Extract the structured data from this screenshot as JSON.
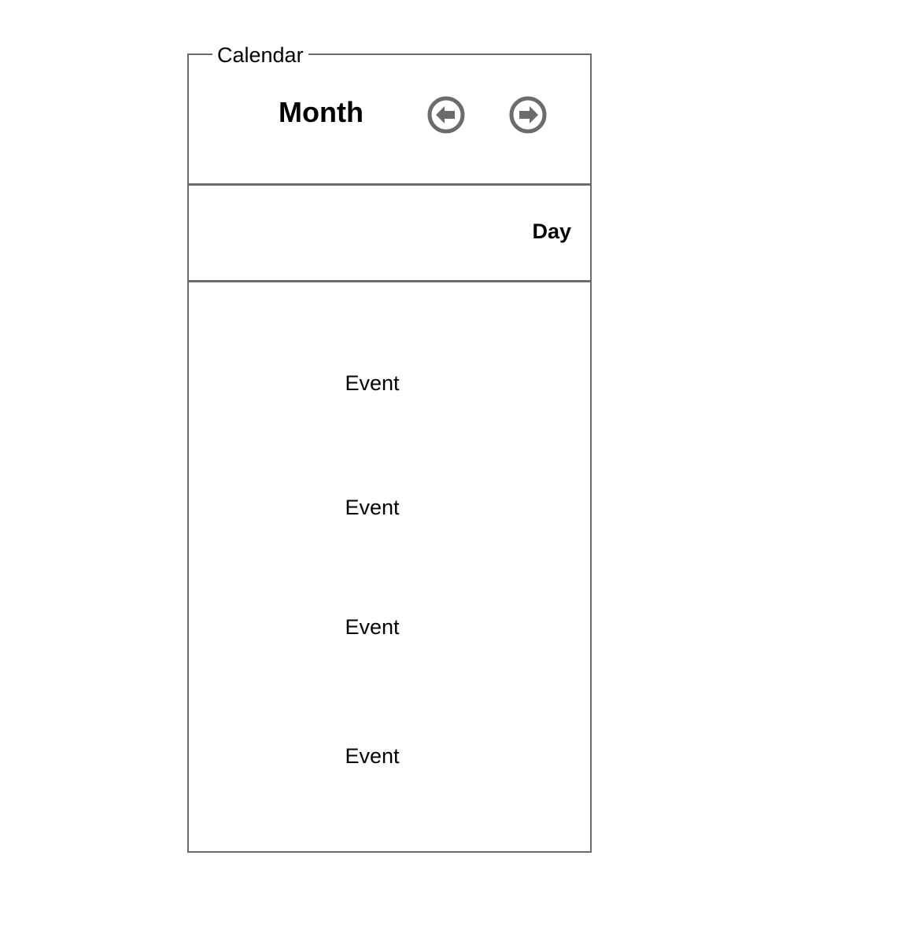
{
  "calendar": {
    "legend": "Calendar",
    "month_label": "Month",
    "prev_icon": "arrow-left-circle-icon",
    "next_icon": "arrow-right-circle-icon",
    "day_label": "Day",
    "events": [
      "Event",
      "Event",
      "Event",
      "Event"
    ]
  },
  "colors": {
    "border": "#6b6b6b",
    "icon": "#6b6b6b",
    "text": "#000000",
    "background": "#ffffff"
  }
}
